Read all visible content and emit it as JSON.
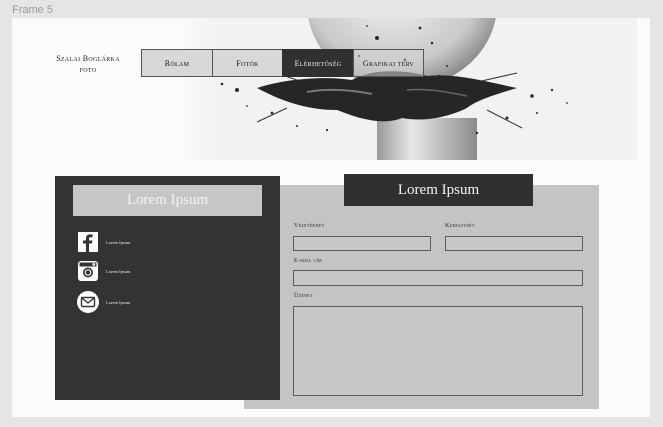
{
  "canvas": {
    "frame_label": "Frame 5"
  },
  "header": {
    "brand_line1": "Szalai Boglárka",
    "brand_line2": "foto",
    "nav": [
      {
        "label": "Rólam",
        "active": false
      },
      {
        "label": "Fotók",
        "active": false
      },
      {
        "label": "Elérhetőség",
        "active": true
      },
      {
        "label": "Grafikai terv",
        "active": false
      }
    ]
  },
  "contact_panel": {
    "title": "Lorem Ipsum",
    "socials": [
      {
        "icon": "facebook-icon",
        "label": "Lorem Ipsum"
      },
      {
        "icon": "instagram-icon",
        "label": "Lorem Ipsum"
      },
      {
        "icon": "mail-icon",
        "label": "Lorem Ipsum"
      }
    ]
  },
  "form": {
    "title": "Lorem Ipsum",
    "lastname_label": "Vezetéknév",
    "firstname_label": "Keresztnév",
    "email_label": "E-mail cím",
    "message_label": "Üzenet",
    "lastname_value": "",
    "firstname_value": "",
    "email_value": "",
    "message_value": ""
  },
  "colors": {
    "dark": "#333333",
    "panel_gray": "#c4c4c4",
    "light_title": "#c6c6c6",
    "active_nav": "#303030"
  }
}
